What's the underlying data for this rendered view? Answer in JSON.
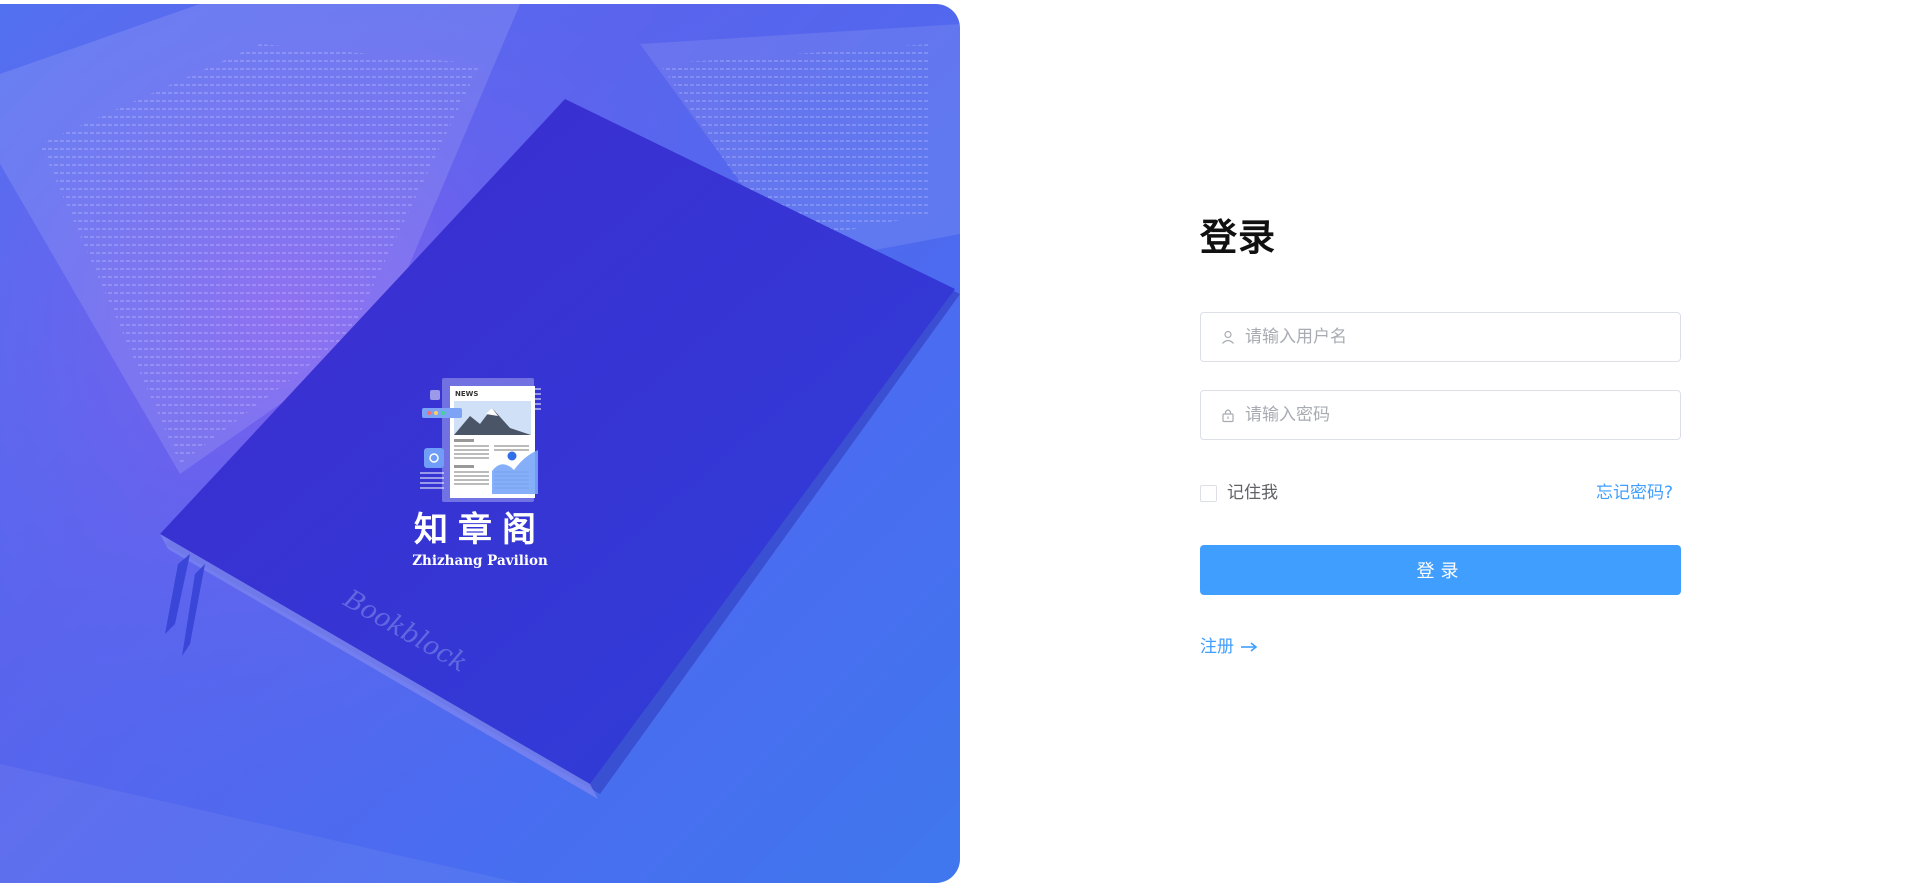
{
  "hero": {
    "book_text": "Bookblock",
    "news_label": "NEWS",
    "brand_cn": "知章阁",
    "brand_en": "Zhizhang Pavilion"
  },
  "login": {
    "title": "登录",
    "username_placeholder": "请输入用户名",
    "password_placeholder": "请输入密码",
    "remember_label": "记住我",
    "forgot_label": "忘记密码?",
    "submit_label": "登录",
    "register_label": "注册"
  },
  "icons": {
    "username": "user-icon",
    "password": "lock-icon",
    "register": "arrow-right-icon"
  },
  "colors": {
    "accent": "#409eff",
    "hero_blue": "#4a6cf0",
    "book": "#3b2fd4"
  }
}
